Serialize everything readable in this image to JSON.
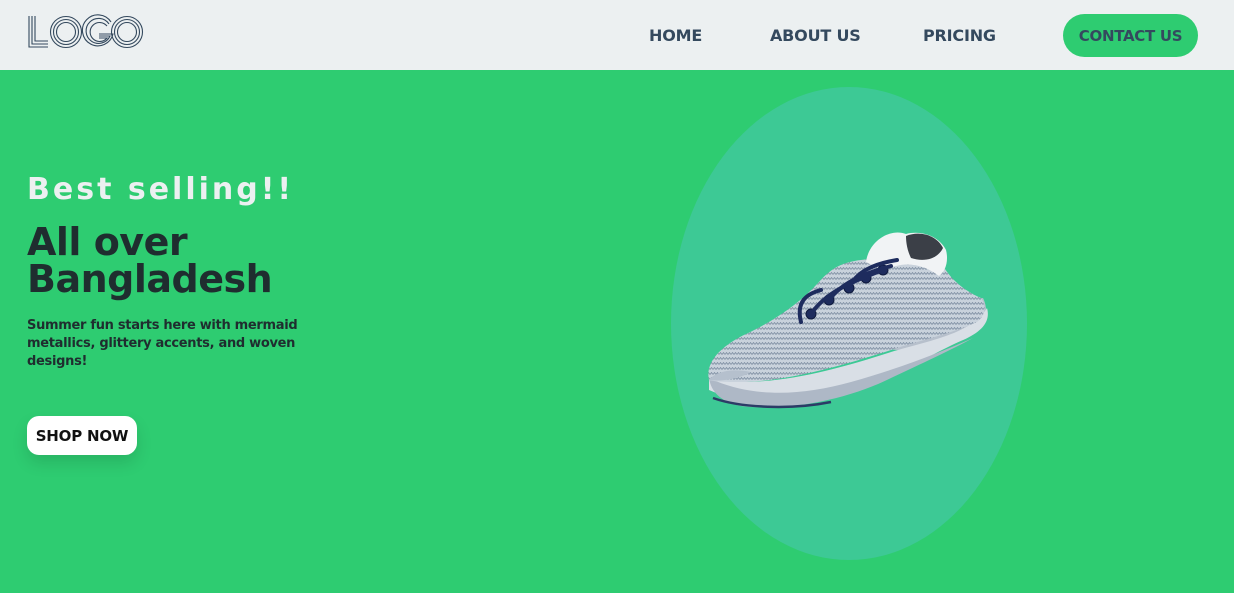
{
  "nav": {
    "logo_text": "LOGO",
    "links": [
      {
        "label": "HOME"
      },
      {
        "label": "ABOUT US"
      },
      {
        "label": "PRICING"
      }
    ],
    "contact_label": "CONTACT US"
  },
  "hero": {
    "kicker": "Best selling!!",
    "title_line1": "All over",
    "title_line2": "Bangladesh",
    "description": "Summer fun starts here with mermaid metallics, glittery accents, and woven designs!",
    "cta_label": "SHOP NOW",
    "product_image": "sneaker-image"
  },
  "colors": {
    "background": "#2ecc71",
    "navbar": "#ecf0f1",
    "nav_text": "#34495e",
    "heading_dark": "#1f2d2f",
    "kicker": "#ecf0f1",
    "oval": "#3dc995",
    "button_white": "#ffffff"
  }
}
